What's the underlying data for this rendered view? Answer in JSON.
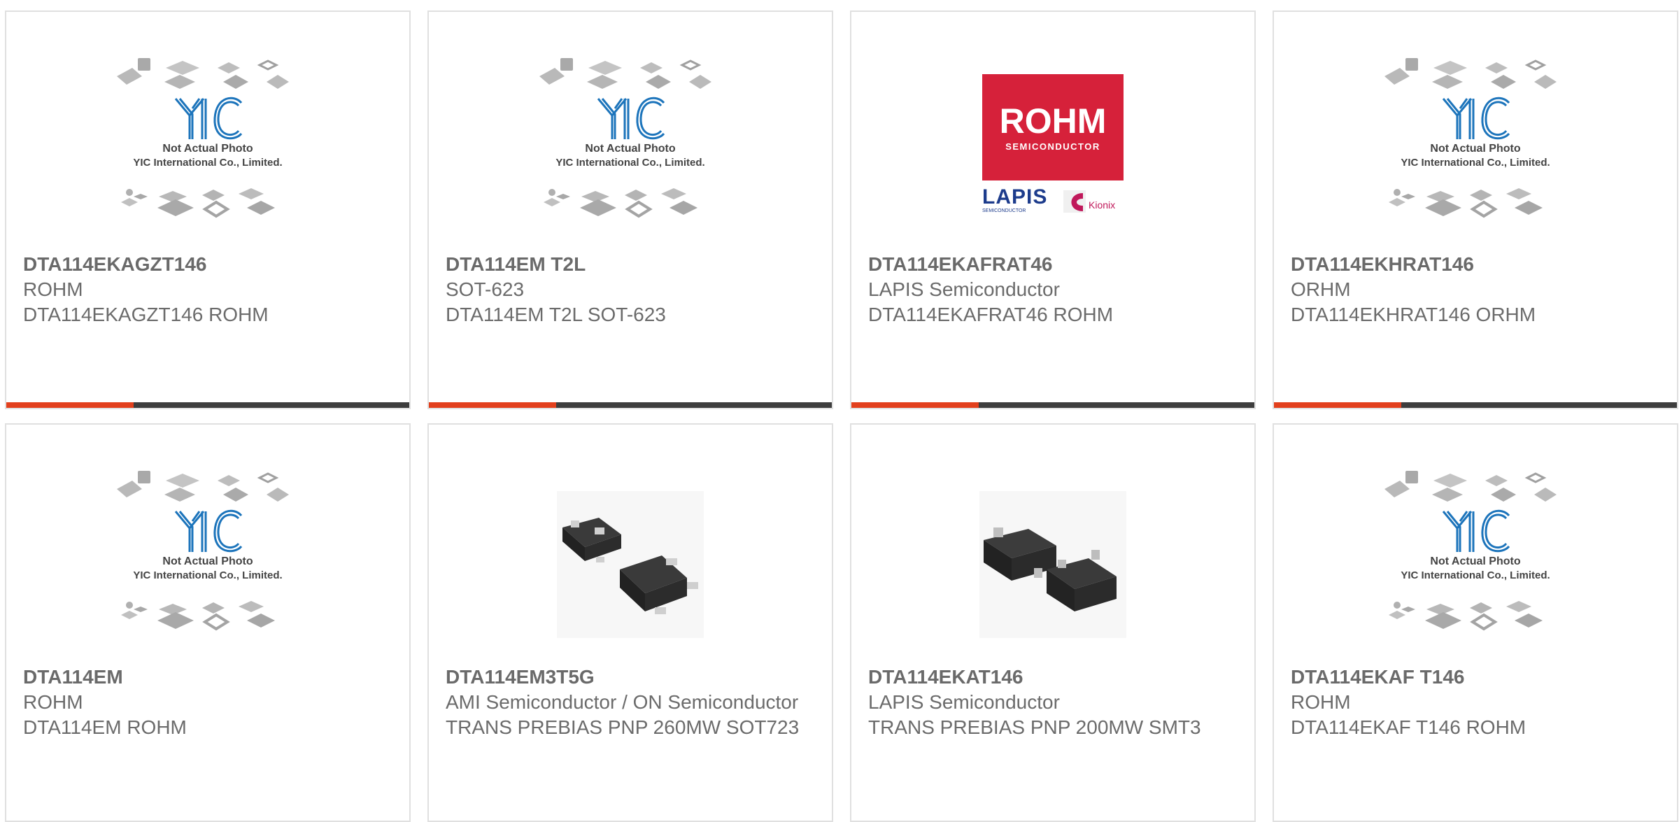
{
  "colors": {
    "accent": "#e2401d",
    "bar": "#3d3d3d",
    "rohm_red": "#d6213a",
    "yic_blue": "#1c74bb",
    "text": "#6b6b6b"
  },
  "placeholder": {
    "line1": "Not Actual Photo",
    "line2": "YIC International Co., Limited.",
    "logo": "YIC"
  },
  "rohm_logo": {
    "brand": "ROHM",
    "sub": "SEMICONDUCTOR",
    "lapis": "LAPIS",
    "lapis_sub": "SEMICONDUCTOR",
    "kionix": "Kionix"
  },
  "products": [
    {
      "part_number": "DTA114EKAGZT146",
      "manufacturer": "ROHM",
      "description": "DTA114EKAGZT146 ROHM",
      "image": "placeholder-icon"
    },
    {
      "part_number": "DTA114EM T2L",
      "manufacturer": "SOT-623",
      "description": "DTA114EM T2L SOT-623",
      "image": "placeholder-icon"
    },
    {
      "part_number": "DTA114EKAFRAT46",
      "manufacturer": "LAPIS Semiconductor",
      "description": "DTA114EKAFRAT46 ROHM",
      "image": "rohm-logo"
    },
    {
      "part_number": "DTA114EKHRAT146",
      "manufacturer": "ORHM",
      "description": "DTA114EKHRAT146 ORHM",
      "image": "placeholder-icon"
    },
    {
      "part_number": "DTA114EM",
      "manufacturer": "ROHM",
      "description": "DTA114EM ROHM",
      "image": "placeholder-icon"
    },
    {
      "part_number": "DTA114EM3T5G",
      "manufacturer": "AMI Semiconductor / ON Semiconductor",
      "description": "TRANS PREBIAS PNP 260MW SOT723",
      "image": "chip-photo"
    },
    {
      "part_number": "DTA114EKAT146",
      "manufacturer": "LAPIS Semiconductor",
      "description": "TRANS PREBIAS PNP 200MW SMT3",
      "image": "chip-photo"
    },
    {
      "part_number": "DTA114EKAF T146",
      "manufacturer": "ROHM",
      "description": "DTA114EKAF T146 ROHM",
      "image": "placeholder-icon"
    }
  ]
}
